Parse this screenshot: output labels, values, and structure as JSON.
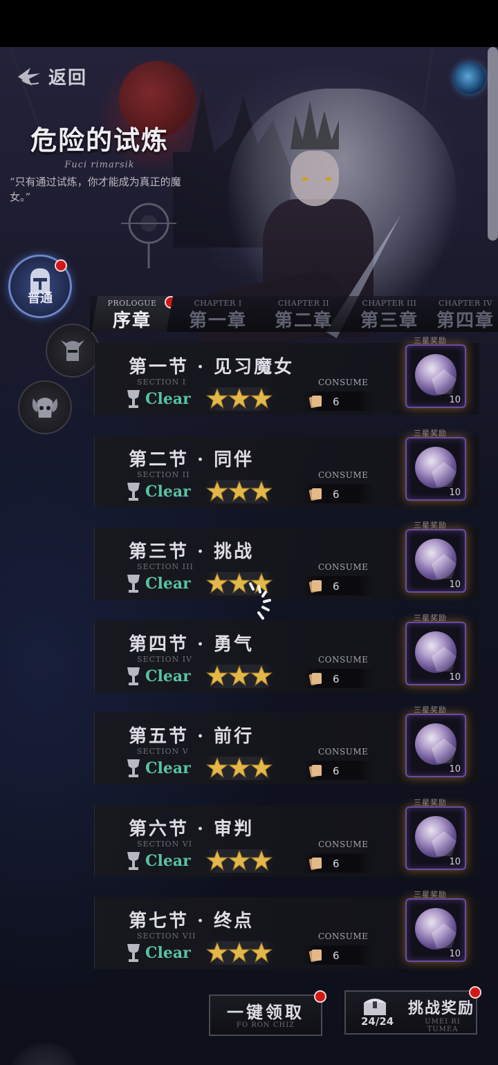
{
  "header": {
    "back_label": "返回",
    "title": "危险的试炼",
    "subtitle": "Fuci rimarsik",
    "quote": "“只有通过试炼，你才能成为真正的魔女。”"
  },
  "modes": [
    {
      "label": "普通",
      "active": true,
      "has_badge": true
    },
    {
      "label": "",
      "active": false
    },
    {
      "label": "",
      "active": false
    }
  ],
  "tabs": [
    {
      "en": "PROLOGUE",
      "zh": "序章",
      "active": true,
      "has_badge": true
    },
    {
      "en": "CHAPTER I",
      "zh": "第一章",
      "active": false
    },
    {
      "en": "CHAPTER II",
      "zh": "第二章",
      "active": false
    },
    {
      "en": "CHAPTER III",
      "zh": "第三章",
      "active": false
    },
    {
      "en": "CHAPTER IV",
      "zh": "第四章",
      "active": false
    }
  ],
  "sections": [
    {
      "name": "第一节 · 见习魔女",
      "en": "SECTION I",
      "status": "Clear",
      "stars": 3,
      "consume_label": "CONSUME",
      "consume": "6",
      "reward_label": "三星奖励",
      "reward_qty": "10"
    },
    {
      "name": "第二节 · 同伴",
      "en": "SECTION II",
      "status": "Clear",
      "stars": 3,
      "consume_label": "CONSUME",
      "consume": "6",
      "reward_label": "三星奖励",
      "reward_qty": "10"
    },
    {
      "name": "第三节 · 挑战",
      "en": "SECTION III",
      "status": "Clear",
      "stars": 3,
      "consume_label": "CONSUME",
      "consume": "6",
      "reward_label": "三星奖励",
      "reward_qty": "10"
    },
    {
      "name": "第四节 · 勇气",
      "en": "SECTION IV",
      "status": "Clear",
      "stars": 3,
      "consume_label": "CONSUME",
      "consume": "6",
      "reward_label": "三星奖励",
      "reward_qty": "10"
    },
    {
      "name": "第五节 · 前行",
      "en": "SECTION V",
      "status": "Clear",
      "stars": 3,
      "consume_label": "CONSUME",
      "consume": "6",
      "reward_label": "三星奖励",
      "reward_qty": "10"
    },
    {
      "name": "第六节 · 审判",
      "en": "SECTION VI",
      "status": "Clear",
      "stars": 3,
      "consume_label": "CONSUME",
      "consume": "6",
      "reward_label": "三星奖励",
      "reward_qty": "10"
    },
    {
      "name": "第七节 · 终点",
      "en": "SECTION VII",
      "status": "Clear",
      "stars": 3,
      "consume_label": "CONSUME",
      "consume": "6",
      "reward_label": "三星奖励",
      "reward_qty": "10"
    }
  ],
  "footer": {
    "claim_all": {
      "zh": "一键领取",
      "en": "FO RON CHIZ",
      "has_badge": true
    },
    "challenge_rewards": {
      "zh": "挑战奖励",
      "en": "UMEI RI TUMEA",
      "progress": "24/24",
      "has_badge": true
    }
  },
  "colors": {
    "clear": "#58c3a4",
    "star": "#e3b84a",
    "badge": "#d01818",
    "reward_glow": "#d28c28"
  }
}
